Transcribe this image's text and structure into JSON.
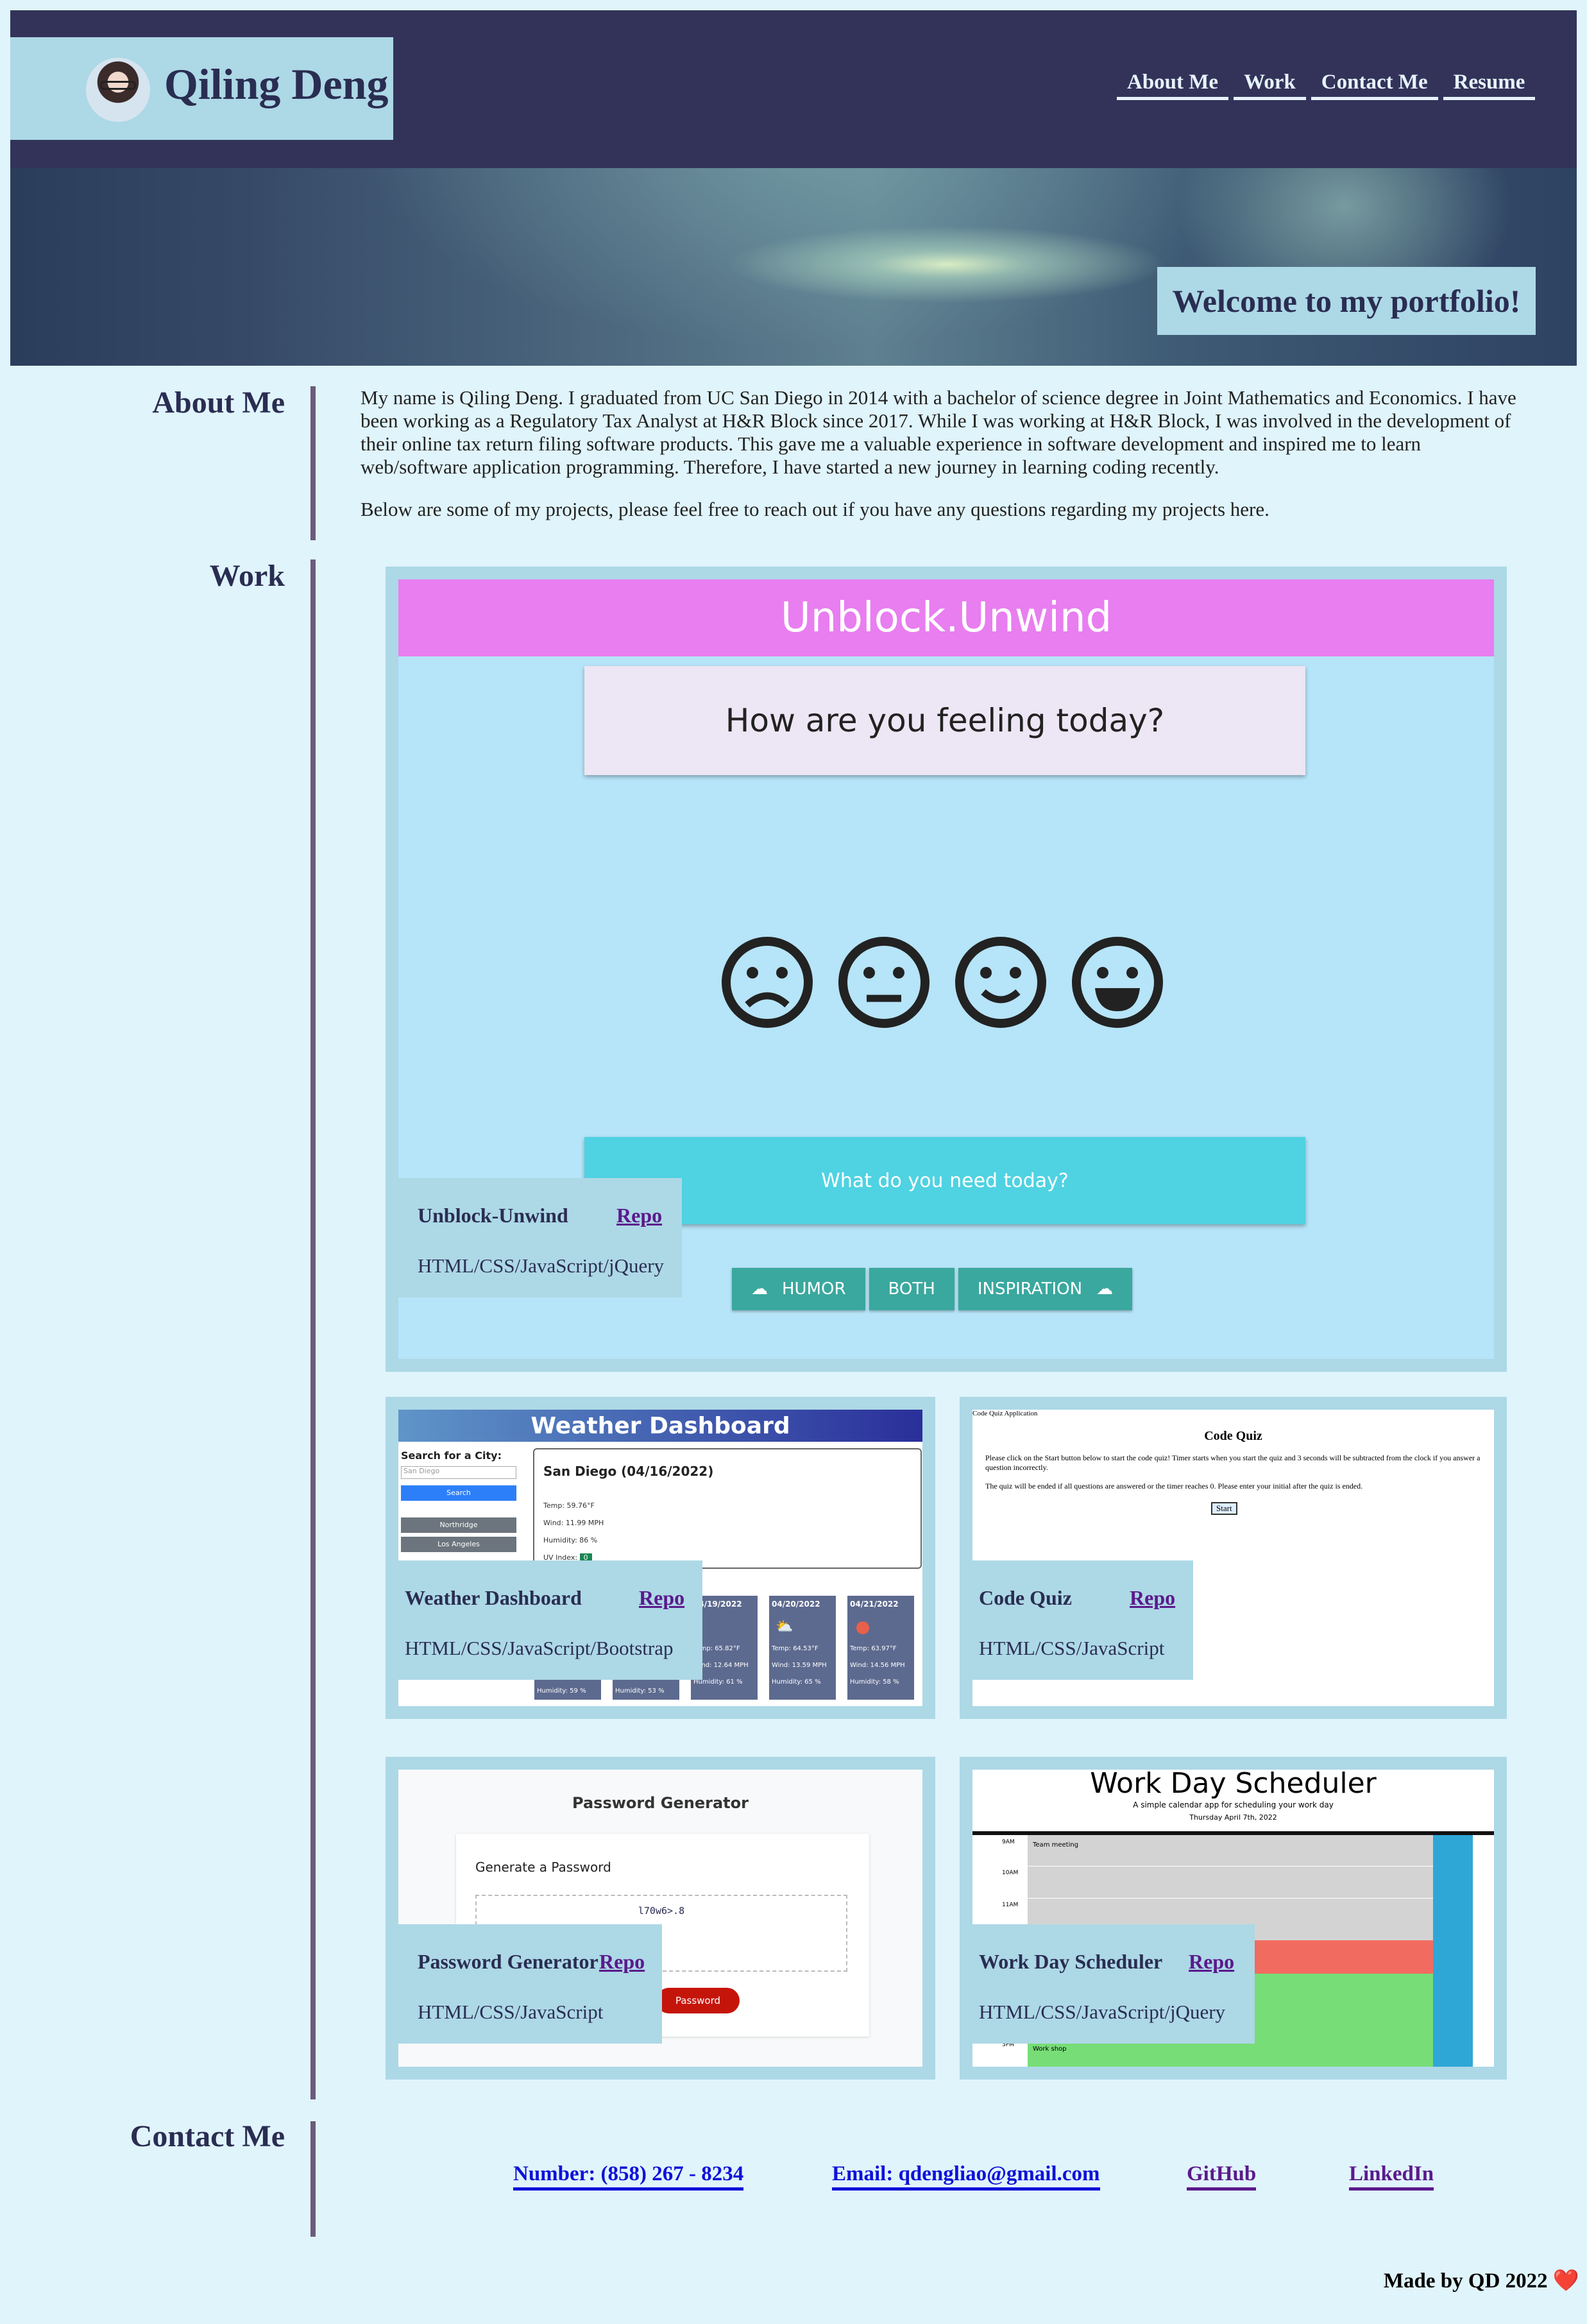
{
  "header": {
    "name": "Qiling Deng",
    "nav": [
      "About Me",
      "Work",
      "Contact Me",
      "Resume"
    ],
    "welcome": "Welcome to my portfolio!"
  },
  "about": {
    "title": "About Me",
    "p1": "My name is Qiling Deng. I graduated from UC San Diego in 2014 with a bachelor of science degree in Joint Mathematics and Economics. I have been working as a Regulatory Tax Analyst at H&R Block since 2017. While I was working at H&R Block, I was involved in the development of their online tax return filing software products. This gave me a valuable experience in software development and inspired me to learn web/software application programming. Therefore, I have started a new journey in learning coding recently.",
    "p2": "Below are some of my projects, please feel free to reach out if you have any questions regarding my projects here."
  },
  "work": {
    "title": "Work",
    "repo": "Repo",
    "projects": [
      {
        "name": "Unblock-Unwind",
        "tech": "HTML/CSS/JavaScript/jQuery"
      },
      {
        "name": "Weather Dashboard",
        "tech": "HTML/CSS/JavaScript/Bootstrap"
      },
      {
        "name": "Code Quiz",
        "tech": "HTML/CSS/JavaScript"
      },
      {
        "name": "Password Generator",
        "tech": "HTML/CSS/JavaScript"
      },
      {
        "name": "Work Day Scheduler",
        "tech": "HTML/CSS/JavaScript/jQuery"
      }
    ]
  },
  "shots": {
    "unblock": {
      "title": "Unblock.Unwind",
      "question": "How are you feeling today?",
      "need": "What do you need today?",
      "buttons": [
        "HUMOR",
        "BOTH",
        "INSPIRATION"
      ]
    },
    "weather": {
      "title": "Weather Dashboard",
      "search": "Search for a City:",
      "placeholder": "San Diego",
      "button": "Search",
      "cities": [
        "Northridge",
        "Los Angeles"
      ],
      "current": "San Diego (04/16/2022)",
      "lines": [
        "Temp: 59.76°F",
        "Wind: 11.99 MPH",
        "Humidity: 86 %",
        "UV Index:"
      ],
      "uv": "0",
      "days": [
        {
          "date": "04/19/2022",
          "t": "Temp: 65.82°F",
          "w": "Wind: 12.64 MPH",
          "h": "Humidity: 61 %"
        },
        {
          "date": "04/20/2022",
          "t": "Temp: 64.53°F",
          "w": "Wind: 13.59 MPH",
          "h": "Humidity: 65 %"
        },
        {
          "date": "04/21/2022",
          "t": "Temp: 63.97°F",
          "w": "Wind: 14.56 MPH",
          "h": "Humidity: 58 %"
        }
      ],
      "hums": [
        "Humidity: 59 %",
        "Humidity: 53 %"
      ]
    },
    "quiz": {
      "app": "Code Quiz Application",
      "title": "Code Quiz",
      "text1": "Please click on the Start button below to start the code quiz! Timer starts when you start the quiz and 3 seconds will be subtracted from the clock if you answer a question incorrectly.",
      "text2": "The quiz will be ended if all questions are answered or the timer reaches 0. Please enter your initial after the quiz is ended.",
      "start": "Start"
    },
    "password": {
      "title": "Password Generator",
      "sub": "Generate a Password",
      "value": "l70w6>.8",
      "button": "Password"
    },
    "scheduler": {
      "title": "Work Day Scheduler",
      "sub": "A simple calendar app for scheduling your work day",
      "date": "Thursday April 7th, 2022",
      "hours": [
        "9AM",
        "10AM",
        "11AM",
        "3PM"
      ],
      "event1": "Team meeting",
      "event2": "Work shop"
    }
  },
  "contact": {
    "title": "Contact Me",
    "phone": "Number: (858) 267 - 8234",
    "email": "Email: qdengliao@gmail.com",
    "github": "GitHub",
    "linkedin": "LinkedIn"
  },
  "footer": "Made by QD 2022 ❤️"
}
